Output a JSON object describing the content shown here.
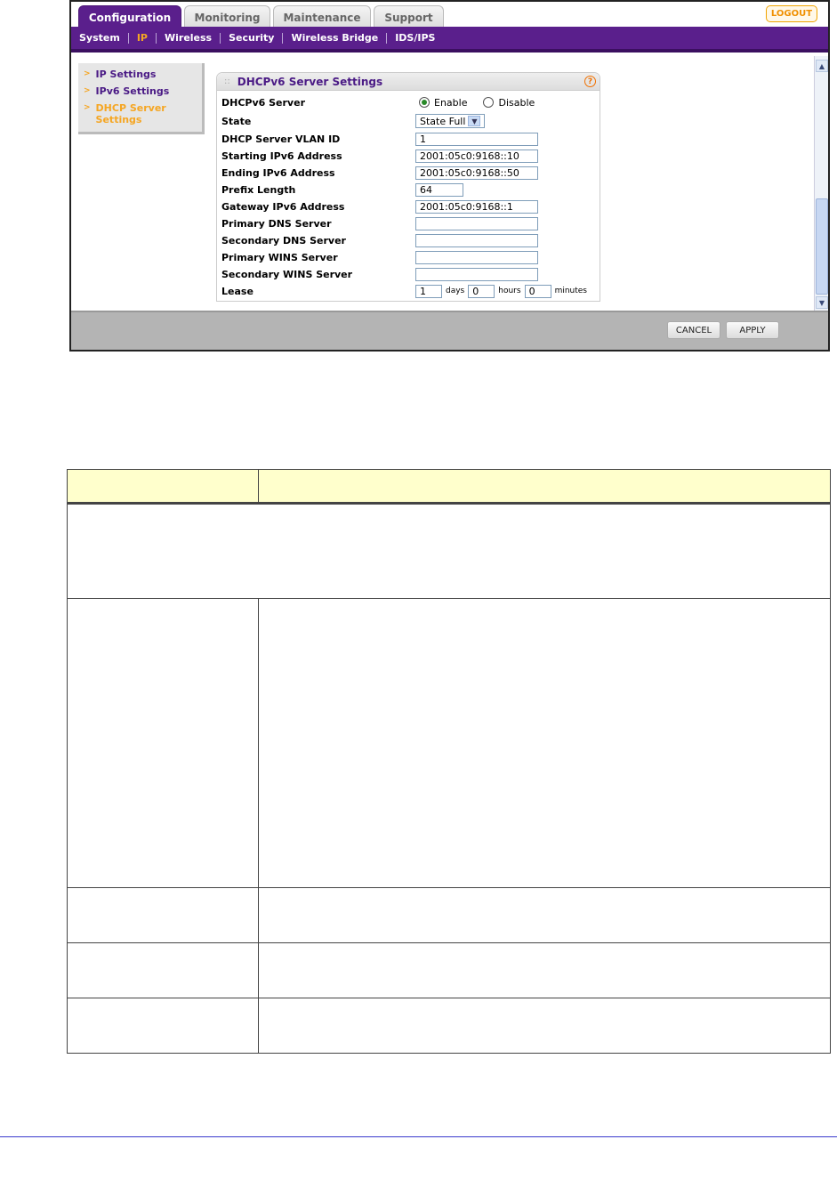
{
  "tabs": [
    {
      "label": "Configuration",
      "active": true
    },
    {
      "label": "Monitoring",
      "active": false
    },
    {
      "label": "Maintenance",
      "active": false
    },
    {
      "label": "Support",
      "active": false
    }
  ],
  "logout_label": "LOGOUT",
  "subnav": [
    {
      "label": "System",
      "active": false
    },
    {
      "label": "IP",
      "active": true
    },
    {
      "label": "Wireless",
      "active": false
    },
    {
      "label": "Security",
      "active": false
    },
    {
      "label": "Wireless Bridge",
      "active": false
    },
    {
      "label": "IDS/IPS",
      "active": false
    }
  ],
  "leftnav": [
    {
      "label": "IP Settings",
      "active": false
    },
    {
      "label": "IPv6 Settings",
      "active": false
    },
    {
      "label": "DHCP Server Settings",
      "active": true
    }
  ],
  "panel": {
    "title": "DHCPv6 Server Settings",
    "help_glyph": "?",
    "fields": {
      "dhcpv6_server": {
        "label": "DHCPv6 Server",
        "enable": "Enable",
        "disable": "Disable",
        "selected": "Enable"
      },
      "state": {
        "label": "State",
        "value": "State Full"
      },
      "vlan_id": {
        "label": "DHCP Server VLAN ID",
        "value": "1"
      },
      "start_addr": {
        "label": "Starting IPv6 Address",
        "value": "2001:05c0:9168::10"
      },
      "end_addr": {
        "label": "Ending IPv6 Address",
        "value": "2001:05c0:9168::50"
      },
      "prefix_len": {
        "label": "Prefix Length",
        "value": "64"
      },
      "gateway": {
        "label": "Gateway IPv6 Address",
        "value": "2001:05c0:9168::1"
      },
      "primary_dns": {
        "label": "Primary DNS Server",
        "value": ""
      },
      "secondary_dns": {
        "label": "Secondary DNS Server",
        "value": ""
      },
      "primary_wins": {
        "label": "Primary WINS Server",
        "value": ""
      },
      "secondary_wins": {
        "label": "Secondary WINS Server",
        "value": ""
      },
      "lease": {
        "label": "Lease",
        "days": "1",
        "days_unit": "days",
        "hours": "0",
        "hours_unit": "hours",
        "minutes": "0",
        "minutes_unit": "minutes"
      }
    }
  },
  "buttons": {
    "cancel": "CANCEL",
    "apply": "APPLY"
  },
  "colors": {
    "brand_purple": "#5a1f8c",
    "accent_orange": "#f5a623",
    "table_header": "#ffffcc"
  }
}
